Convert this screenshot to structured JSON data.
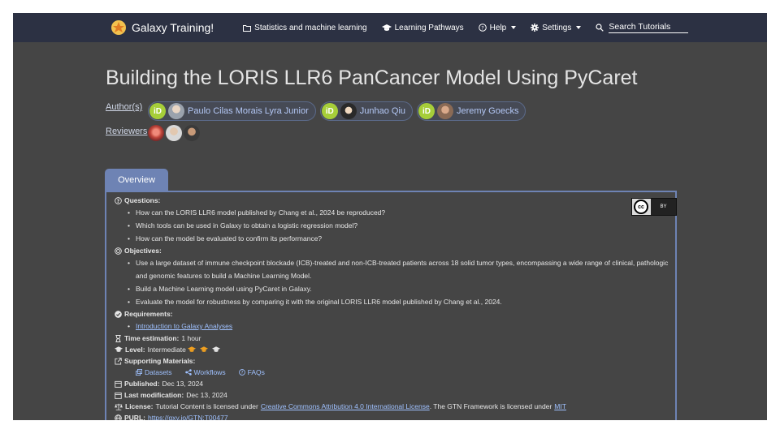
{
  "nav": {
    "brand": "Galaxy Training!",
    "links": [
      {
        "label": "Statistics and machine learning",
        "icon": "folder-icon"
      },
      {
        "label": "Learning Pathways",
        "icon": "graduation-cap-icon"
      },
      {
        "label": "Help",
        "icon": "help-circle-icon"
      },
      {
        "label": "Settings",
        "icon": "gear-icon"
      }
    ],
    "search_label": "Search Tutorials"
  },
  "page": {
    "title": "Building the LORIS LLR6 PanCancer Model Using PyCaret",
    "authors_label": "Author(s)",
    "reviewers_label": "Reviewers",
    "authors": [
      {
        "name": "Paulo Cilas Morais Lyra Junior"
      },
      {
        "name": "Junhao Qiu"
      },
      {
        "name": "Jeremy Goecks"
      }
    ],
    "orcid_text": "iD"
  },
  "tab": {
    "label": "Overview"
  },
  "overview": {
    "cc_label": "cc",
    "by_label": "BY",
    "questions_label": "Questions:",
    "questions": [
      "How can the LORIS LLR6 model published by Chang et al., 2024 be reproduced?",
      "Which tools can be used in Galaxy to obtain a logistic regression model?",
      "How can the model be evaluated to confirm its performance?"
    ],
    "objectives_label": "Objectives:",
    "objectives": [
      "Use a large dataset of immune checkpoint blockade (ICB)-treated and non-ICB-treated patients across 18 solid tumor types, encompassing a wide range of clinical, pathologic and genomic features to build a Machine Learning Model.",
      "Build a Machine Learning model using PyCaret in Galaxy.",
      "Evaluate the model for robustness by comparing it with the original LORIS LLR6 model published by Chang et al., 2024."
    ],
    "requirements_label": "Requirements:",
    "requirement_link": "Introduction to Galaxy Analyses",
    "time_label": "Time estimation:",
    "time_value": "1 hour",
    "level_label": "Level:",
    "level_value": "Intermediate",
    "supporting_label": "Supporting Materials:",
    "supporting_links": [
      "Datasets",
      "Workflows",
      "FAQs"
    ],
    "published_label": "Published:",
    "published_value": "Dec 13, 2024",
    "modified_label": "Last modification:",
    "modified_value": "Dec 13, 2024",
    "license_label": "License:",
    "license_text_1": "Tutorial Content is licensed under",
    "license_link": "Creative Commons Attribution 4.0 International License",
    "license_text_2": ". The GTN Framework is licensed under",
    "license_mit": "MIT",
    "purl_label": "PURL:",
    "purl_value": "https://gxy.io/GTN:T00477"
  },
  "colors": {
    "navbar": "#2c3143",
    "background": "#454545",
    "accent": "#6e83b4",
    "link": "#9fc1ff",
    "orcid": "#a6ce39",
    "level_hat": "#f0a020"
  }
}
